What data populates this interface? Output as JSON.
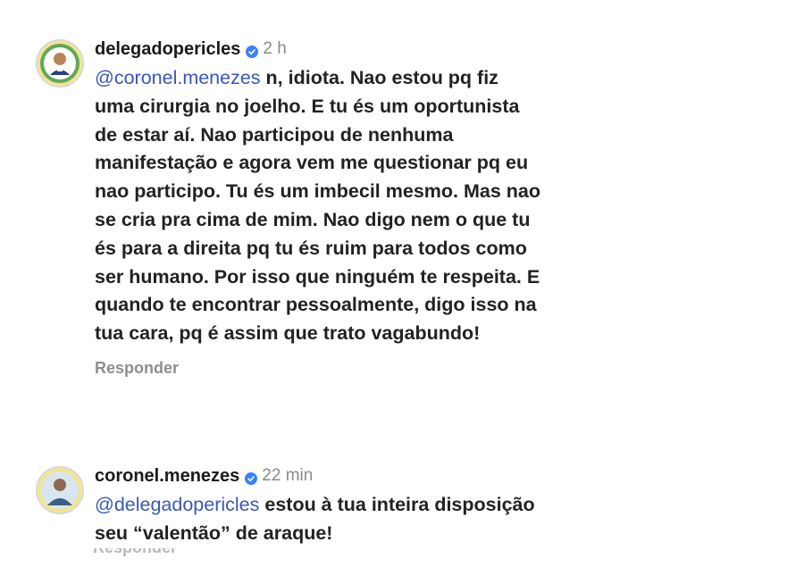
{
  "comments": [
    {
      "username": "delegadopericles",
      "time": "2 h",
      "mention": "@coronel.menezes",
      "text": " n, idiota. Nao estou pq fiz uma cirurgia no joelho. E tu és um oportunista de estar aí. Nao participou de nenhuma manifestação e agora vem me questionar pq eu nao participo. Tu és um imbecil mesmo. Mas nao se cria pra cima de mim. Nao digo nem o que tu és para a direita pq tu és ruim para todos como ser humano. Por isso que ninguém te respeita. E quando te encontrar pessoalmente, digo isso na tua cara, pq é assim que trato vagabundo!",
      "reply_label": "Responder",
      "avatar_icon": "profile-photo-man-yellow-green-frame"
    },
    {
      "username": "coronel.menezes",
      "time": "22 min",
      "mention": "@delegadopericles",
      "text": " estou à tua inteira disposição seu “valentão” de araque!",
      "reply_label": "Responder",
      "avatar_icon": "profile-photo-man-blue-shirt"
    }
  ],
  "colors": {
    "mention": "#3a57b8",
    "verified": "#3b82f6",
    "secondary_text": "#8a8a8a"
  }
}
